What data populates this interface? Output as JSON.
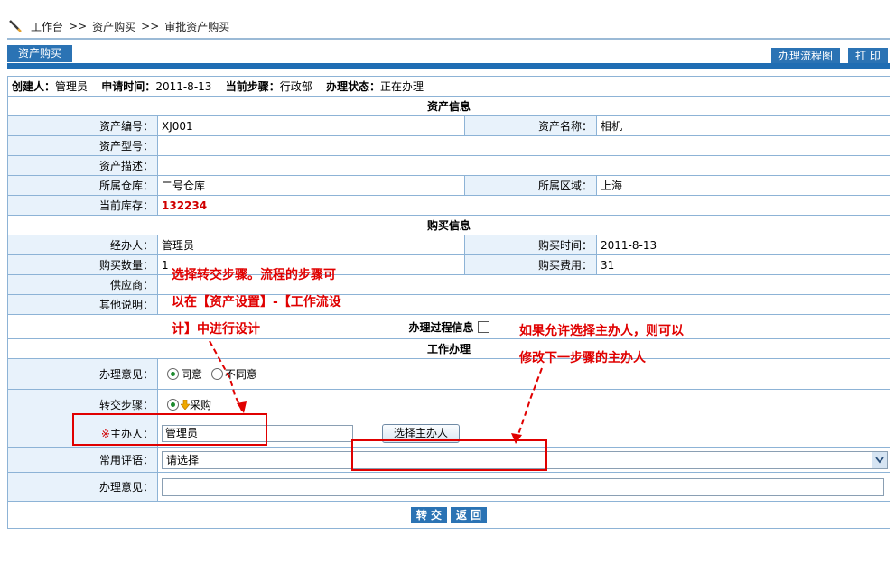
{
  "breadcrumb": {
    "items": [
      "工作台",
      "资产购买",
      "审批资产购买"
    ],
    "separator": ">>"
  },
  "toolbar": {
    "tab_label": "资产购买",
    "flow_label": "办理流程图",
    "print_label": "打 印"
  },
  "header": {
    "creator_label": "创建人：",
    "creator": "管理员",
    "apply_time_label": "申请时间：",
    "apply_time": "2011-8-13",
    "current_step_label": "当前步骤：",
    "current_step": "行政部",
    "status_label": "办理状态：",
    "status": "正在办理"
  },
  "asset_info": {
    "title": "资产信息",
    "code_label": "资产编号：",
    "code": "XJ001",
    "name_label": "资产名称：",
    "name": "相机",
    "model_label": "资产型号：",
    "model": "",
    "desc_label": "资产描述：",
    "desc": "",
    "warehouse_label": "所属仓库：",
    "warehouse": "二号仓库",
    "region_label": "所属区域：",
    "region": "上海",
    "stock_label": "当前库存：",
    "stock": "132234"
  },
  "purchase_info": {
    "title": "购买信息",
    "handler_label": "经办人：",
    "handler": "管理员",
    "time_label": "购买时间：",
    "time": "2011-8-13",
    "qty_label": "购买数量：",
    "qty": "1",
    "cost_label": "购买费用：",
    "cost": "31",
    "supplier_label": "供应商：",
    "supplier": "",
    "other_label": "其他说明：",
    "other": ""
  },
  "process_info_label": "办理过程信息",
  "work": {
    "title": "工作办理",
    "opinion_label": "办理意见：",
    "opinion_options": [
      "同意",
      "不同意"
    ],
    "next_step_label": "转交步骤：",
    "next_step": "采购",
    "host_required": "※",
    "host_label": "主办人：",
    "host_value": "管理员",
    "host_button": "选择主办人",
    "common_comment_label": "常用评语：",
    "common_comment_value": "请选择",
    "opinion_text_label": "办理意见：",
    "opinion_text": ""
  },
  "actions": {
    "submit": "转 交",
    "back": "返 回"
  },
  "annotations": {
    "note1_line1": "选择转交步骤。流程的步骤可",
    "note1_line2": "以在【资产设置】-【工作流设",
    "note1_line3": "计】中进行设计",
    "note2_line1": "如果允许选择主办人，则可以",
    "note2_line2": "修改下一步骤的主办人"
  },
  "colors": {
    "accent": "#2b73b4",
    "annotation": "#e00000",
    "label_bg": "#e8f2fb",
    "border": "#8db3d6"
  }
}
